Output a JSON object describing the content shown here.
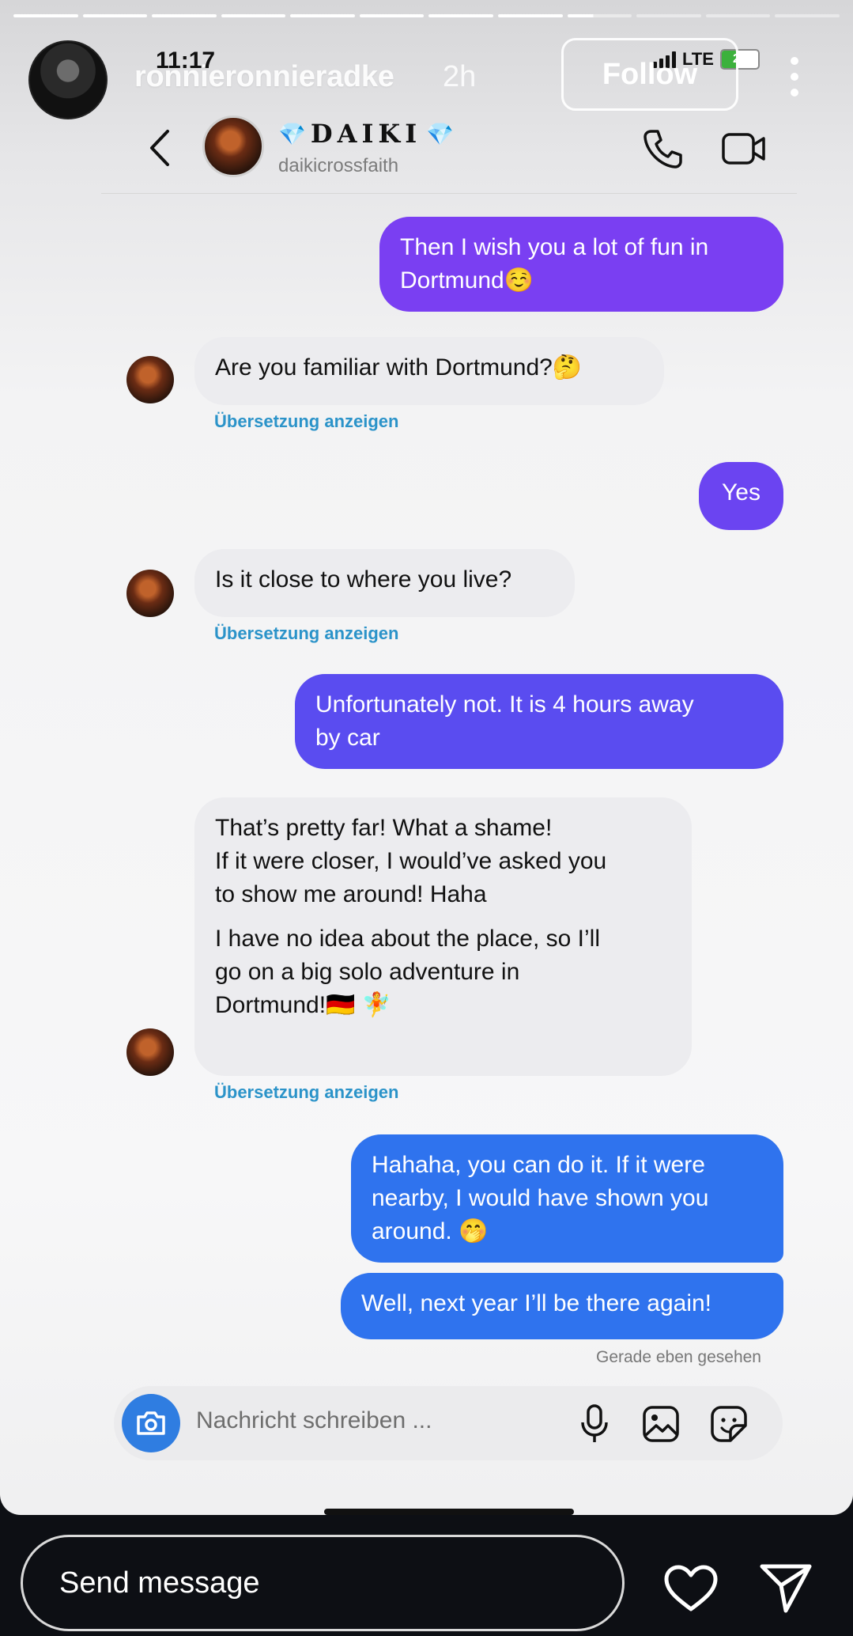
{
  "story": {
    "username": "ronnieronnieradke",
    "time_ago": "2h",
    "follow_label": "Follow",
    "progress": {
      "segments": 12,
      "completed": 8,
      "current_fraction": 0.4
    }
  },
  "status_bar": {
    "time": "11:17",
    "network": "LTE",
    "battery": "28"
  },
  "chat_header": {
    "display_name": "DAIKI",
    "name_decoration": "💎",
    "handle": "daikicrossfaith"
  },
  "messages": [
    {
      "from": "me",
      "lines": [
        "Then I wish you a lot of fun in",
        "Dortmund☺️"
      ]
    },
    {
      "from": "them",
      "lines": [
        "Are you familiar with Dortmund?🤔"
      ],
      "translate": "Übersetzung anzeigen"
    },
    {
      "from": "me",
      "lines": [
        "Yes"
      ]
    },
    {
      "from": "them",
      "lines": [
        "Is it close to where you live?"
      ],
      "translate": "Übersetzung anzeigen"
    },
    {
      "from": "me",
      "lines": [
        "Unfortunately not. It is 4 hours away",
        "by car"
      ]
    },
    {
      "from": "them",
      "lines": [
        "That’s pretty far! What a shame!",
        "If it were closer, I would’ve asked you",
        "to show me around! Haha",
        "",
        "I have no idea about the place, so I’ll",
        "go on a big solo adventure in",
        "Dortmund!🇩🇪 🧚"
      ],
      "translate": "Übersetzung anzeigen"
    },
    {
      "from": "me",
      "lines": [
        "Hahaha, you can do it. If it were",
        "nearby, I would have shown you",
        "around. 🤭"
      ]
    },
    {
      "from": "me",
      "lines": [
        "Well, next year I’ll be there again!"
      ]
    }
  ],
  "seen_status": "Gerade eben gesehen",
  "composer": {
    "placeholder": "Nachricht schreiben ..."
  },
  "reply_bar": {
    "placeholder": "Send message"
  },
  "colors": {
    "bubble_purple": "#7a3ff2",
    "bubble_indigo": "#5a4cf0",
    "bubble_blue": "#2f73ee",
    "translate_link": "#2b93c9",
    "camera_button": "#2f7de1"
  },
  "icons": [
    "back-icon",
    "phone-icon",
    "video-icon",
    "camera-icon",
    "mic-icon",
    "gallery-icon",
    "sticker-icon",
    "heart-icon",
    "send-icon",
    "more-icon"
  ]
}
